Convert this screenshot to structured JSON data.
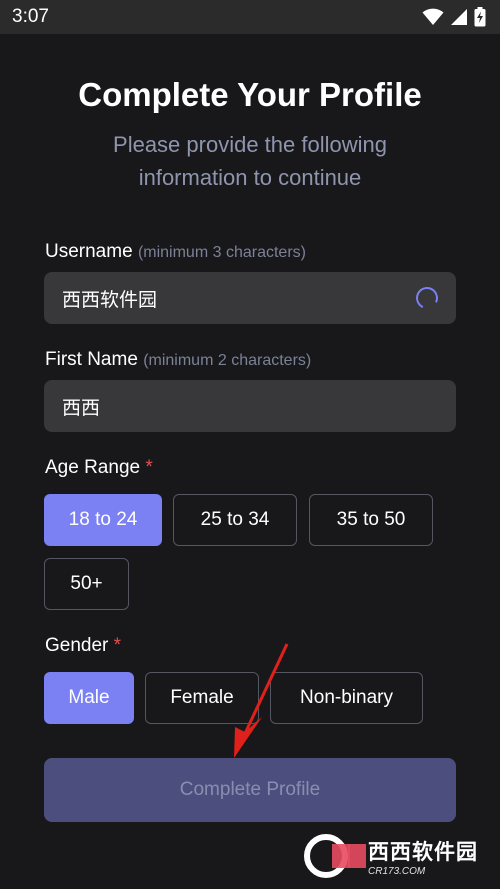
{
  "status_bar": {
    "time": "3:07",
    "icons": [
      "wifi-icon",
      "signal-icon",
      "battery-charging-icon"
    ]
  },
  "header": {
    "title": "Complete Your Profile",
    "subtitle": "Please provide the following information to continue"
  },
  "form": {
    "username": {
      "label": "Username",
      "hint": "(minimum 3 characters)",
      "value": "西西软件园"
    },
    "first_name": {
      "label": "First Name",
      "hint": "(minimum 2 characters)",
      "value": "西西"
    },
    "age_range": {
      "label": "Age Range",
      "required_mark": "*",
      "options": [
        "18 to 24",
        "25 to 34",
        "35 to 50",
        "50+"
      ],
      "selected": "18 to 24"
    },
    "gender": {
      "label": "Gender",
      "required_mark": "*",
      "options": [
        "Male",
        "Female",
        "Non-binary"
      ],
      "selected": "Male"
    },
    "submit_label": "Complete Profile"
  },
  "watermark": {
    "text": "西西软件园",
    "sub": "CR173.COM"
  },
  "colors": {
    "accent": "#7b80f2",
    "background": "#18181b",
    "input_bg": "#38383b",
    "required": "#e35050",
    "annotation_arrow": "#e0201a"
  }
}
